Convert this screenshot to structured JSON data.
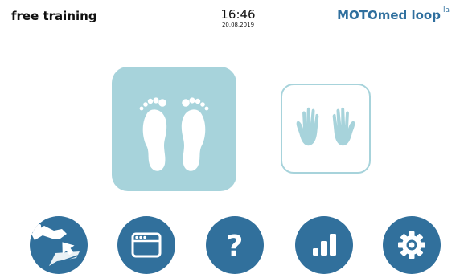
{
  "header": {
    "mode": "free training",
    "time": "16:46",
    "date": "20.08.2019",
    "brand": "MOTOmed loop",
    "brand_suffix": "la"
  },
  "modes": [
    {
      "id": "legs",
      "icon": "feet-icon",
      "selected": true
    },
    {
      "id": "arms",
      "icon": "hands-icon",
      "selected": false
    }
  ],
  "nav": [
    {
      "id": "patient-transfer",
      "icon": "leg-in-footrest-icon"
    },
    {
      "id": "programs",
      "icon": "window-icon"
    },
    {
      "id": "help",
      "icon": "question-mark-icon"
    },
    {
      "id": "statistics",
      "icon": "bar-chart-icon"
    },
    {
      "id": "settings",
      "icon": "gear-icon"
    }
  ],
  "colors": {
    "brand": "#2f6f9e",
    "nav_button": "#31709c",
    "selected_mode": "#a7d3db"
  }
}
